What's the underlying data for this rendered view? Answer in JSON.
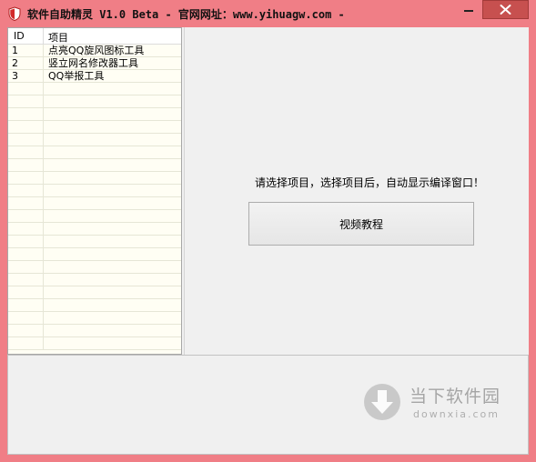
{
  "window": {
    "title": "软件自助精灵 V1.0 Beta - 官网网址：www.yihuagw.com -",
    "close_label": "✕",
    "minimize_label": "–"
  },
  "list": {
    "columns": [
      "ID",
      "项目"
    ],
    "rows": [
      {
        "id": "1",
        "name": "点亮QQ旋风图标工具"
      },
      {
        "id": "2",
        "name": "竖立网名修改器工具"
      },
      {
        "id": "3",
        "name": "QQ举报工具"
      }
    ]
  },
  "main": {
    "hint": "请选择项目，选择项目后，自动显示编译窗口！",
    "video_button": "视频教程"
  },
  "watermark": {
    "title": "当下软件园",
    "subtitle": "downxia.com"
  }
}
